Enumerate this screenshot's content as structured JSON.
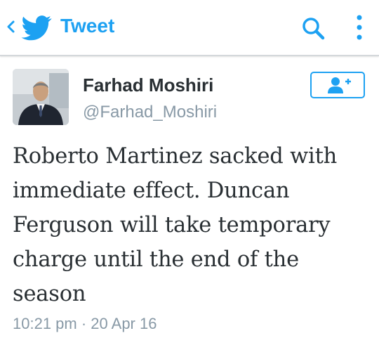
{
  "appbar": {
    "title": "Tweet",
    "back_icon": "chevron-left-icon",
    "logo_icon": "twitter-bird-icon",
    "search_icon": "search-icon",
    "overflow_icon": "more-vertical-icon",
    "accent_color": "#1da1f2"
  },
  "tweet": {
    "author_name": "Farhad Moshiri",
    "author_handle": "@Farhad_Moshiri",
    "follow_icon": "add-user-icon",
    "text": "Roberto Martinez sacked with immediate effect. Duncan Ferguson will take temporary charge until the end of the season",
    "timestamp": "10:21 pm · 20 Apr 16"
  }
}
